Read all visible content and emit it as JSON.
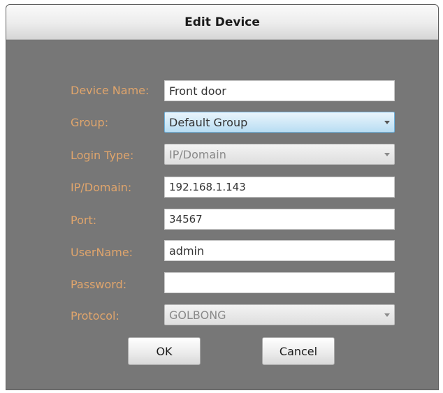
{
  "dialog": {
    "title": "Edit Device"
  },
  "form": {
    "device_name": {
      "label": "Device Name:",
      "value": "Front door"
    },
    "group": {
      "label": "Group:",
      "value": "Default Group"
    },
    "login_type": {
      "label": "Login Type:",
      "value": "IP/Domain"
    },
    "ip_domain": {
      "label": "IP/Domain:",
      "value": "192.168.1.143"
    },
    "port": {
      "label": "Port:",
      "value": "34567"
    },
    "username": {
      "label": "UserName:",
      "value": "admin"
    },
    "password": {
      "label": "Password:",
      "value": ""
    },
    "protocol": {
      "label": "Protocol:",
      "value": "GOLBONG"
    }
  },
  "buttons": {
    "ok": "OK",
    "cancel": "Cancel"
  },
  "colors": {
    "label": "#e0a56c",
    "panel": "#777777",
    "combo_active": "#cfe8f7"
  },
  "icons": {
    "dropdown": "chevron-down-icon"
  }
}
